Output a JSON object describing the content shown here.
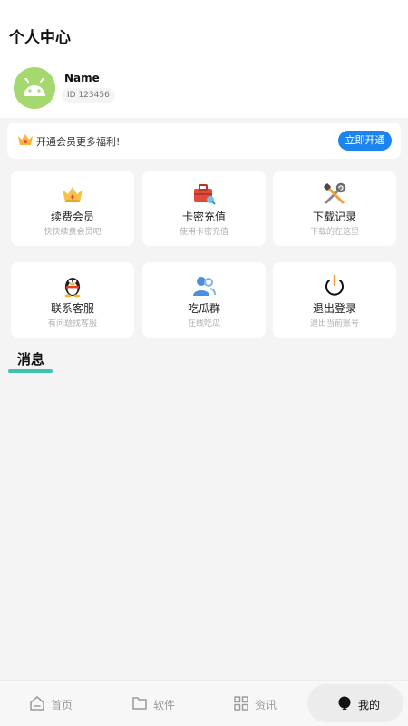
{
  "header": {
    "title": "个人中心"
  },
  "profile": {
    "name": "Name",
    "id": "ID 123456",
    "avatar_icon": "android-icon"
  },
  "vip": {
    "icon": "crown-icon",
    "text": "开通会员更多福利!",
    "button": "立即开通"
  },
  "grid": [
    {
      "icon": "crown-icon",
      "label": "续费会员",
      "sub": "快快续费会员吧"
    },
    {
      "icon": "briefcase-key-icon",
      "label": "卡密充值",
      "sub": "使用卡密充值"
    },
    {
      "icon": "tools-icon",
      "label": "下载记录",
      "sub": "下载的在这里"
    },
    {
      "icon": "qq-penguin-icon",
      "label": "联系客服",
      "sub": "有问题找客服"
    },
    {
      "icon": "group-icon",
      "label": "吃瓜群",
      "sub": "在线吃瓜"
    },
    {
      "icon": "power-icon",
      "label": "退出登录",
      "sub": "退出当前账号"
    }
  ],
  "messages": {
    "title": "消息"
  },
  "tabs": [
    {
      "icon": "home-icon",
      "label": "首页"
    },
    {
      "icon": "folder-icon",
      "label": "软件"
    },
    {
      "icon": "grid-icon",
      "label": "资讯"
    },
    {
      "icon": "user-icon",
      "label": "我的",
      "active": true
    }
  ],
  "colors": {
    "accent": "#1b84ef",
    "indicator": "#3cc3b0",
    "avatar_bg": "#a5d86e"
  }
}
